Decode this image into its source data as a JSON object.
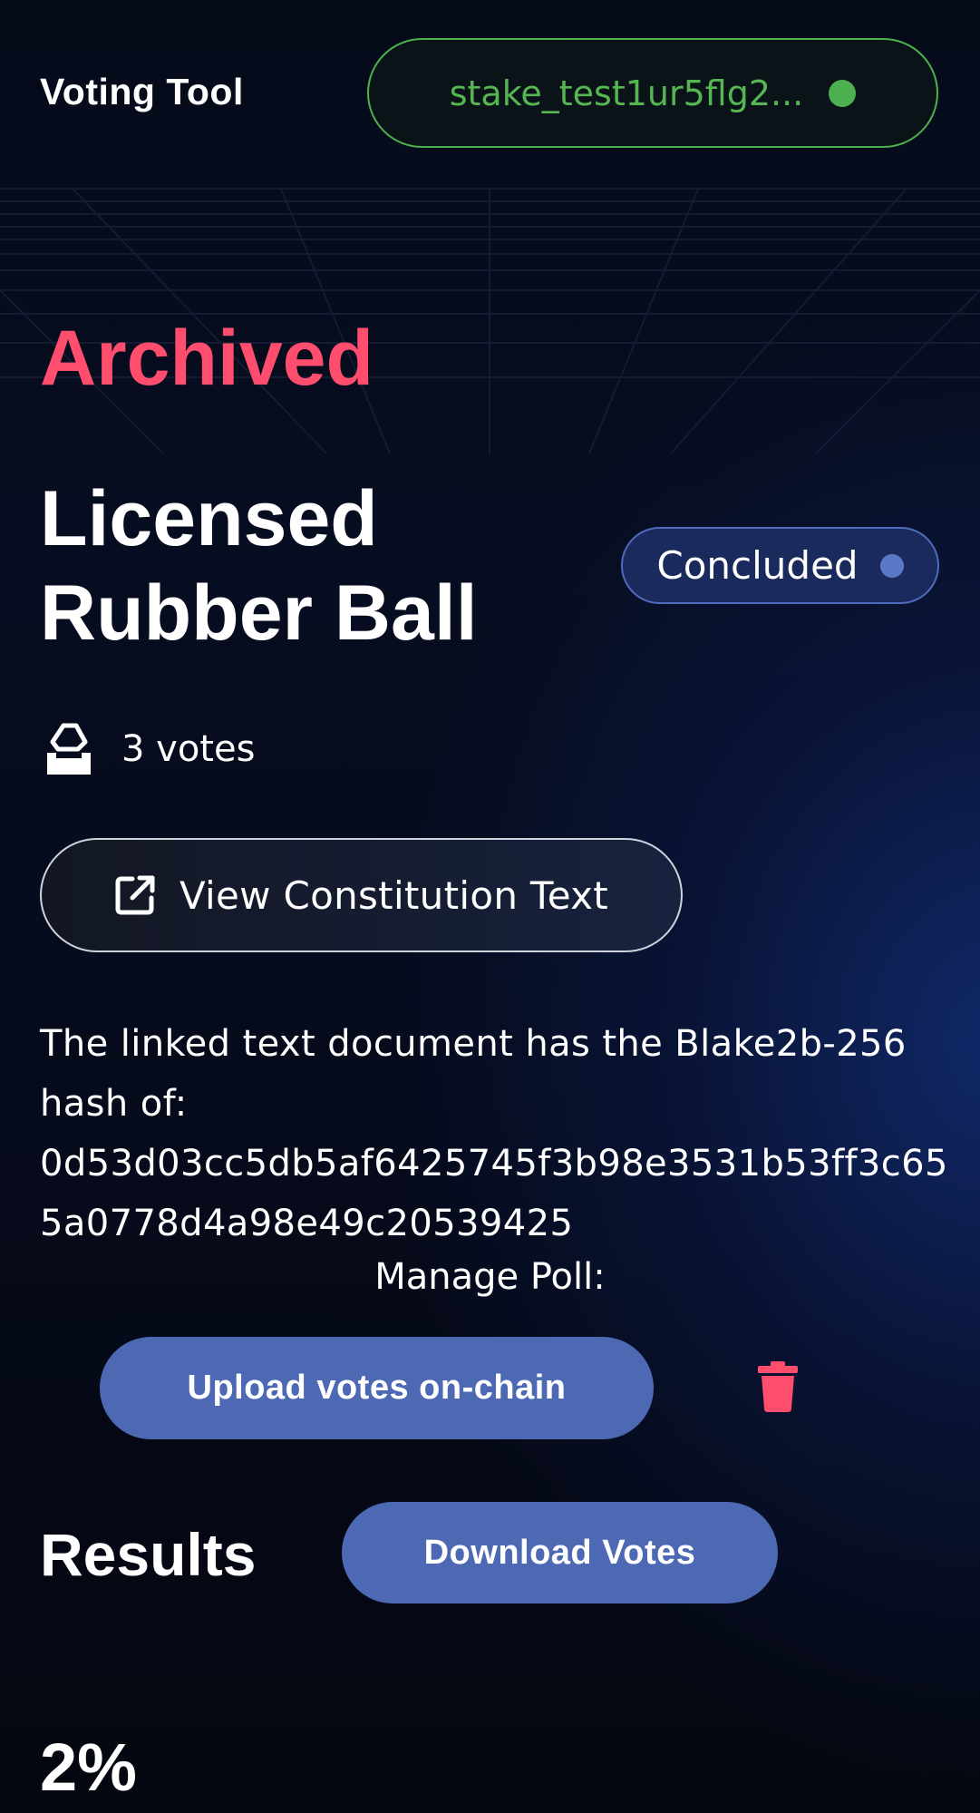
{
  "header": {
    "app_title": "Voting Tool",
    "wallet": {
      "address": "stake_test1ur5flg2...",
      "status_color": "#4caf50",
      "icon": "connected-dot-icon"
    }
  },
  "poll": {
    "state_label": "Archived",
    "title": "Licensed Rubber Ball",
    "status": {
      "label": "Concluded",
      "icon": "status-dot-icon"
    },
    "votes": {
      "icon": "ballot-box-icon",
      "label": "3 votes"
    },
    "constitution_button": {
      "icon": "external-link-icon",
      "label": "View Constitution Text"
    },
    "hash": {
      "intro": "The linked text document has the Blake2b-256 hash of:",
      "value": "0d53d03cc5db5af6425745f3b98e3531b53ff3c655a0778d4a98e49c20539425"
    }
  },
  "manage": {
    "label": "Manage Poll:",
    "upload_button": "Upload votes on-chain",
    "delete_icon": "trash-icon"
  },
  "results": {
    "heading": "Results",
    "download_button": "Download Votes",
    "first_percentage": "2%"
  },
  "colors": {
    "accent_red": "#ff4d6e",
    "primary_button": "#4e69b3",
    "wallet_green": "#56b651",
    "badge_bg": "#1a2a5c"
  }
}
